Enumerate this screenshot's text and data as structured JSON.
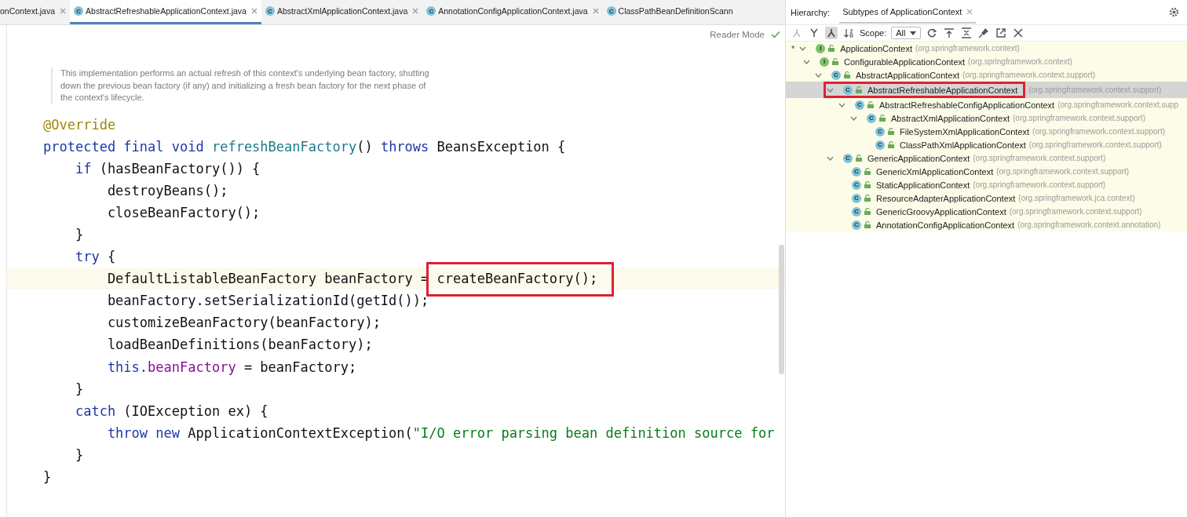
{
  "editor_tabs": [
    {
      "label": "onContext.java",
      "selected": false
    },
    {
      "label": "AbstractRefreshableApplicationContext.java",
      "badge": "C",
      "selected": true
    },
    {
      "label": "AbstractXmlApplicationContext.java",
      "badge": "C",
      "selected": false
    },
    {
      "label": "AnnotationConfigApplicationContext.java",
      "badge": "C",
      "selected": false
    },
    {
      "label": "ClassPathBeanDefinitionScann",
      "badge": "C",
      "selected": false
    }
  ],
  "reader_mode": "Reader Mode",
  "doc_comment": "This implementation performs an actual refresh of this context's underlying bean factory, shutting down the previous bean factory (if any) and initializing a fresh bean factory for the next phase of the context's lifecycle.",
  "code_lines": [
    {
      "tokens": [
        {
          "kind": "ann",
          "text": "@Override"
        }
      ]
    },
    {
      "tokens": [
        {
          "kind": "kw",
          "text": "protected final void "
        },
        {
          "kind": "fn",
          "text": "refreshBeanFactory"
        },
        {
          "kind": "plain",
          "text": "() "
        },
        {
          "kind": "kw",
          "text": "throws "
        },
        {
          "kind": "plain",
          "text": "BeansException {"
        }
      ]
    },
    {
      "tokens": [
        {
          "kind": "kw",
          "text": "    if "
        },
        {
          "kind": "plain",
          "text": "(hasBeanFactory()) {"
        }
      ]
    },
    {
      "tokens": [
        {
          "kind": "plain",
          "text": "        destroyBeans();"
        }
      ]
    },
    {
      "tokens": [
        {
          "kind": "plain",
          "text": "        closeBeanFactory();"
        }
      ]
    },
    {
      "tokens": [
        {
          "kind": "plain",
          "text": "    }"
        }
      ]
    },
    {
      "tokens": [
        {
          "kind": "kw",
          "text": "    try "
        },
        {
          "kind": "plain",
          "text": "{"
        }
      ]
    },
    {
      "current": true,
      "tokens": [
        {
          "kind": "plain",
          "text": "        DefaultListableBeanFactory beanFactory = "
        },
        {
          "kind": "plain",
          "text": "createBeanFactory();",
          "highlight": true
        }
      ]
    },
    {
      "tokens": [
        {
          "kind": "plain",
          "text": "        beanFactory.setSerializationId(getId());"
        }
      ]
    },
    {
      "tokens": [
        {
          "kind": "plain",
          "text": "        customizeBeanFactory(beanFactory);"
        }
      ]
    },
    {
      "tokens": [
        {
          "kind": "plain",
          "text": "        loadBeanDefinitions(beanFactory);"
        }
      ]
    },
    {
      "tokens": [
        {
          "kind": "kw",
          "text": "        this."
        },
        {
          "kind": "field",
          "text": "beanFactory"
        },
        {
          "kind": "plain",
          "text": " = beanFactory;"
        }
      ]
    },
    {
      "tokens": [
        {
          "kind": "plain",
          "text": "    }"
        }
      ]
    },
    {
      "tokens": [
        {
          "kind": "kw",
          "text": "    catch "
        },
        {
          "kind": "plain",
          "text": "(IOException ex) {"
        }
      ]
    },
    {
      "tokens": [
        {
          "kind": "kw",
          "text": "        throw new "
        },
        {
          "kind": "plain",
          "text": "ApplicationContextException("
        },
        {
          "kind": "str",
          "text": "\"I/O error parsing bean definition source for"
        }
      ]
    },
    {
      "tokens": [
        {
          "kind": "plain",
          "text": "    }"
        }
      ]
    },
    {
      "tokens": [
        {
          "kind": "plain",
          "text": "}"
        }
      ]
    }
  ],
  "hierarchy": {
    "label": "Hierarchy:",
    "tab": "Subtypes of ApplicationContext",
    "scope_label": "Scope:",
    "scope_value": "All",
    "tree": [
      {
        "name": "ApplicationContext",
        "package": "(org.springframework.context)",
        "marker": "*",
        "badge": "I",
        "kind": "interface",
        "expanded": true,
        "selected": false,
        "children": [
          {
            "name": "ConfigurableApplicationContext",
            "package": "(org.springframework.context)",
            "badge": "I",
            "kind": "interface",
            "expanded": true,
            "selected": false,
            "children": [
              {
                "name": "AbstractApplicationContext",
                "package": "(org.springframework.context.support)",
                "badge": "C",
                "kind": "class",
                "expanded": true,
                "selected": false,
                "children": [
                  {
                    "name": "AbstractRefreshableApplicationContext",
                    "package": "(org.springframework.context.support)",
                    "badge": "C",
                    "kind": "class",
                    "expanded": true,
                    "selected": true,
                    "highlight": true,
                    "children": [
                      {
                        "name": "AbstractRefreshableConfigApplicationContext",
                        "package": "(org.springframework.context.supp",
                        "badge": "C",
                        "kind": "class",
                        "expanded": true,
                        "selected": false,
                        "children": [
                          {
                            "name": "AbstractXmlApplicationContext",
                            "package": "(org.springframework.context.support)",
                            "badge": "C",
                            "kind": "class",
                            "expanded": true,
                            "selected": false,
                            "children": [
                              {
                                "name": "FileSystemXmlApplicationContext",
                                "package": "(org.springframework.context.support)",
                                "badge": "C",
                                "kind": "class",
                                "selected": false
                              },
                              {
                                "name": "ClassPathXmlApplicationContext",
                                "package": "(org.springframework.context.support)",
                                "badge": "C",
                                "kind": "class",
                                "selected": false
                              }
                            ]
                          }
                        ]
                      }
                    ]
                  },
                  {
                    "name": "GenericApplicationContext",
                    "package": "(org.springframework.context.support)",
                    "badge": "C",
                    "kind": "class",
                    "expanded": true,
                    "selected": false,
                    "children": [
                      {
                        "name": "GenericXmlApplicationContext",
                        "package": "(org.springframework.context.support)",
                        "badge": "C",
                        "kind": "class",
                        "selected": false
                      },
                      {
                        "name": "StaticApplicationContext",
                        "package": "(org.springframework.context.support)",
                        "badge": "C",
                        "kind": "class",
                        "selected": false
                      },
                      {
                        "name": "ResourceAdapterApplicationContext",
                        "package": "(org.springframework.jca.context)",
                        "badge": "C",
                        "kind": "class",
                        "selected": false
                      },
                      {
                        "name": "GenericGroovyApplicationContext",
                        "package": "(org.springframework.context.support)",
                        "badge": "C",
                        "kind": "class",
                        "selected": false
                      },
                      {
                        "name": "AnnotationConfigApplicationContext",
                        "package": "(org.springframework.context.annotation)",
                        "badge": "C",
                        "kind": "class",
                        "selected": false
                      }
                    ]
                  }
                ]
              }
            ]
          }
        ]
      }
    ]
  }
}
